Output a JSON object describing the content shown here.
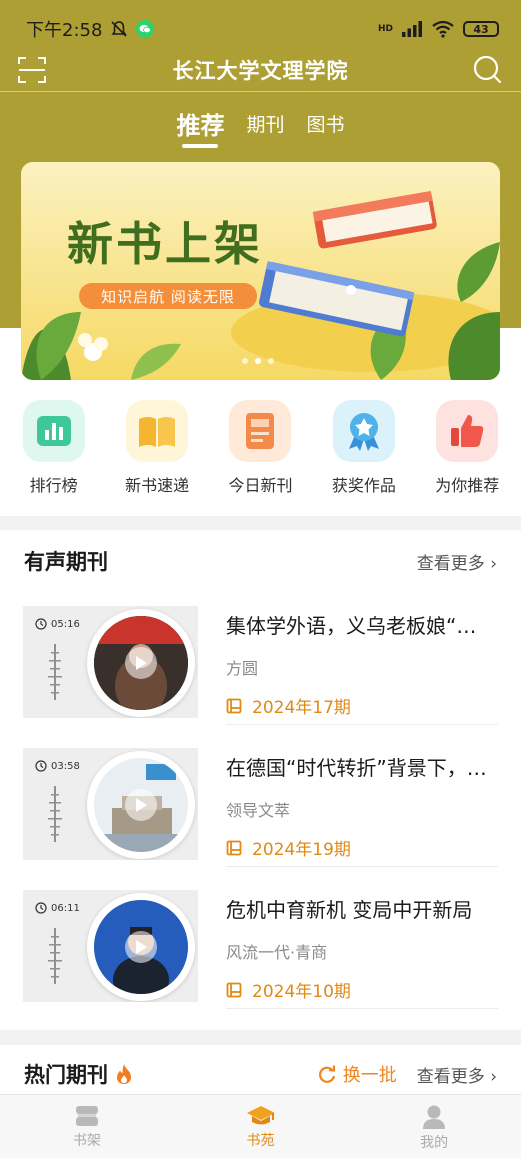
{
  "status_bar": {
    "time": "下午2:58",
    "network": "HD",
    "battery": "43"
  },
  "header": {
    "title": "长江大学文理学院",
    "tabs": [
      {
        "label": "推荐",
        "active": true
      },
      {
        "label": "期刊",
        "active": false
      },
      {
        "label": "图书",
        "active": false
      }
    ]
  },
  "banner": {
    "title": "新书上架",
    "subtitle": "知识启航 阅读无限",
    "page_count": 3,
    "active_index": 1
  },
  "quick_entries": [
    {
      "label": "排行榜",
      "icon": "ranking-icon"
    },
    {
      "label": "新书速递",
      "icon": "new-book-icon"
    },
    {
      "label": "今日新刊",
      "icon": "new-journal-icon"
    },
    {
      "label": "获奖作品",
      "icon": "award-icon"
    },
    {
      "label": "为你推荐",
      "icon": "thumbs-up-icon"
    }
  ],
  "audio_section": {
    "title": "有声期刊",
    "more": "查看更多",
    "items": [
      {
        "duration": "05:16",
        "title": "集体学外语，义乌老板娘“…",
        "source": "方圆",
        "issue": "2024年17期"
      },
      {
        "duration": "03:58",
        "title": "在德国“时代转折”背景下，…",
        "source": "领导文萃",
        "issue": "2024年19期"
      },
      {
        "duration": "06:11",
        "title": "危机中育新机 变局中开新局",
        "source": "风流一代·青商",
        "issue": "2024年10期"
      }
    ]
  },
  "hot_section": {
    "title": "热门期刊",
    "refresh": "换一批",
    "more": "查看更多"
  },
  "bottom_nav": [
    {
      "label": "书架",
      "icon": "bookshelf-icon",
      "active": false
    },
    {
      "label": "书苑",
      "icon": "graduation-cap-icon",
      "active": true
    },
    {
      "label": "我的",
      "icon": "user-icon",
      "active": false
    }
  ],
  "colors": {
    "header_bg": "#ae9f35",
    "accent": "#e08a14",
    "banner_title": "#3f6f1e",
    "banner_pill": "#f38e3a"
  }
}
